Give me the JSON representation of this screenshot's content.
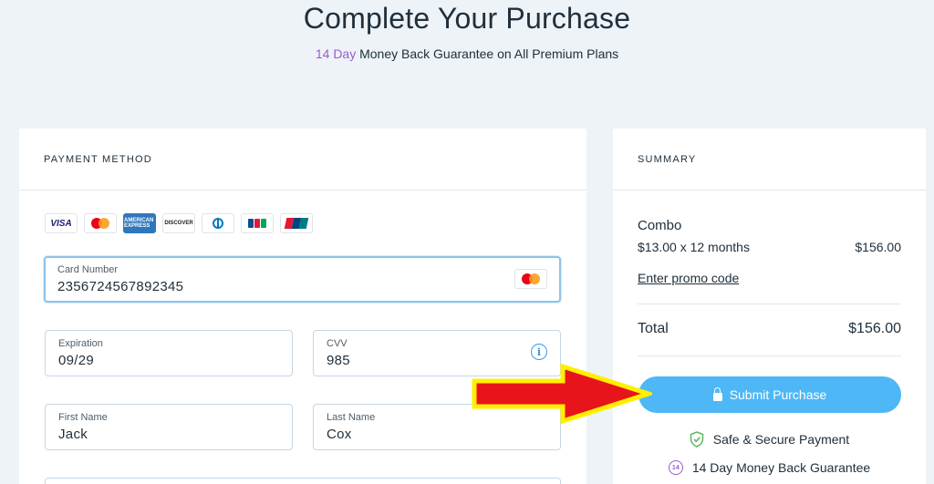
{
  "header": {
    "title": "Complete Your Purchase",
    "subtitle_accent": "14 Day",
    "subtitle_rest": " Money Back Guarantee on All Premium Plans"
  },
  "payment": {
    "section_title": "PAYMENT METHOD",
    "brands": [
      {
        "name": "visa-icon",
        "text": "VISA"
      },
      {
        "name": "mastercard-icon",
        "text": ""
      },
      {
        "name": "amex-icon",
        "text": "AMERICAN EXPRESS"
      },
      {
        "name": "discover-icon",
        "text": "DISCOVER"
      },
      {
        "name": "diners-icon",
        "text": ""
      },
      {
        "name": "jcb-icon",
        "text": ""
      },
      {
        "name": "unionpay-icon",
        "text": ""
      }
    ],
    "card_number": {
      "label": "Card Number",
      "value": "2356724567892345"
    },
    "expiration": {
      "label": "Expiration",
      "value": "09/29"
    },
    "cvv": {
      "label": "CVV",
      "value": "985"
    },
    "first_name": {
      "label": "First Name",
      "value": "Jack"
    },
    "last_name": {
      "label": "Last Name",
      "value": "Cox"
    }
  },
  "summary": {
    "section_title": "SUMMARY",
    "plan_name": "Combo",
    "plan_price_desc": "$13.00 x 12 months",
    "plan_price_total": "$156.00",
    "promo_link": "Enter promo code",
    "total_label": "Total",
    "total_value": "$156.00",
    "submit_label": "Submit Purchase",
    "trust_secure": "Safe & Secure Payment",
    "trust_guarantee": "14 Day Money Back Guarantee",
    "guarantee_badge": "14"
  },
  "colors": {
    "accent_purple": "#9a5bd1",
    "button_blue": "#4eb7f5",
    "annotation_arrow_red": "#e8141c",
    "annotation_arrow_yellow": "#ffef00"
  }
}
